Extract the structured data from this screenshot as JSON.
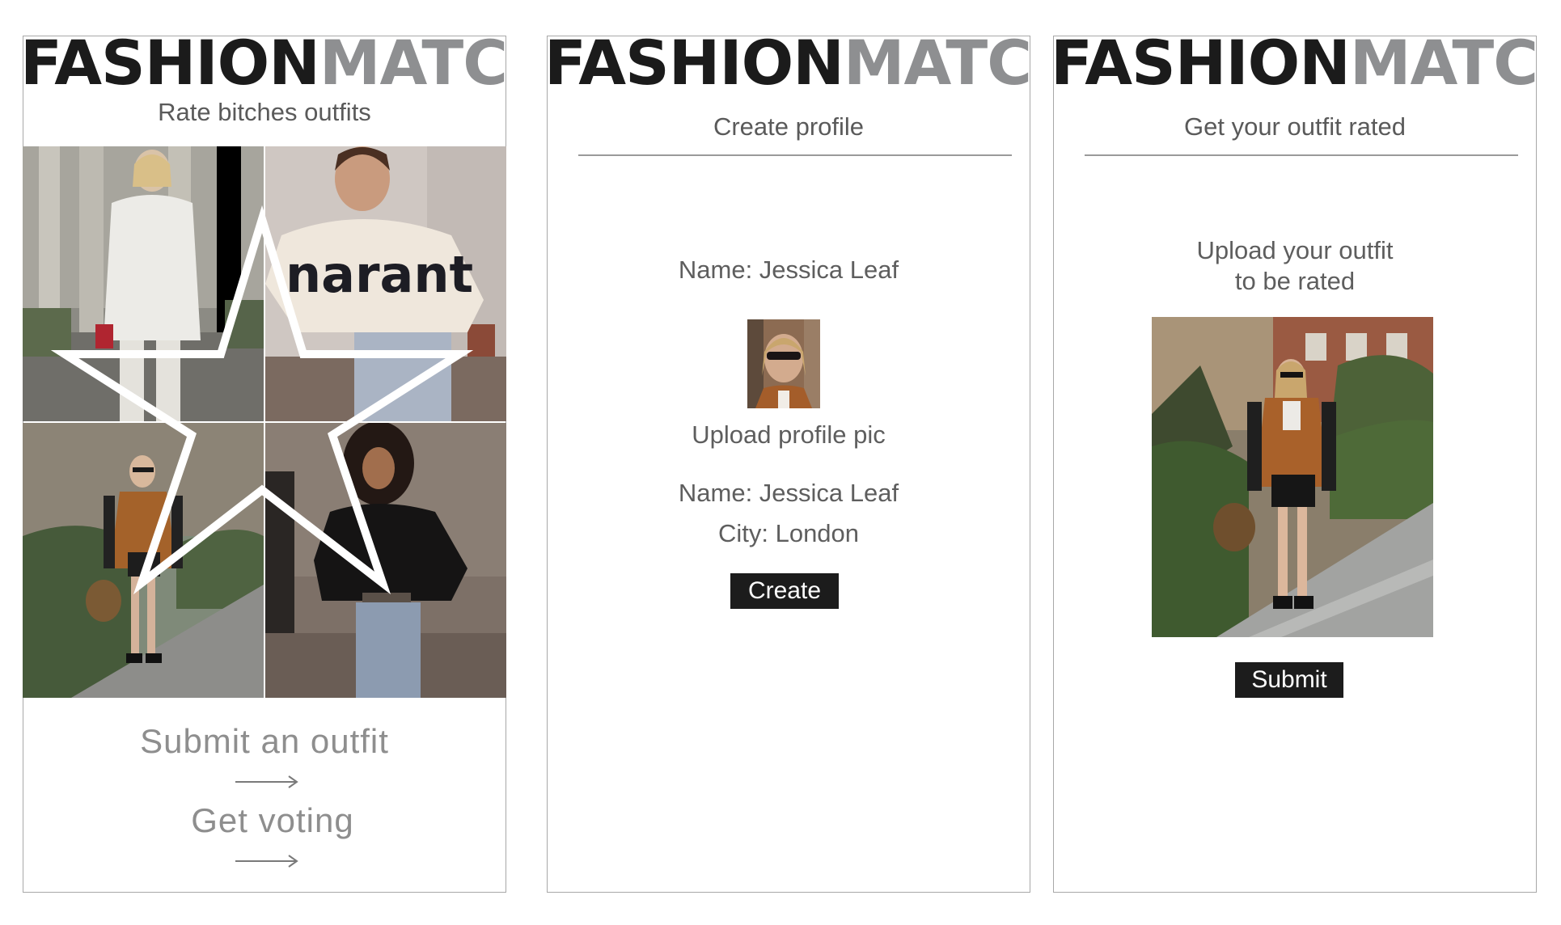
{
  "brand": {
    "part1": "FASHION",
    "part2": "MATCH"
  },
  "screens": [
    {
      "subtitle": "Rate bitches outfits",
      "images": [
        "woman in white blazer",
        "woman in isabel marant sweater",
        "woman in varsity jacket",
        "woman in black leather jacket"
      ],
      "star_icon": "star-outline",
      "cta1": "Submit an outfit",
      "cta2": "Get voting"
    },
    {
      "subtitle": "Create profile",
      "name_label": "Name: Jessica Leaf",
      "upload_label": "Upload profile pic",
      "name_value": "Name: Jessica Leaf",
      "city_value": "City: London",
      "button": "Create"
    },
    {
      "subtitle": "Get your outfit rated",
      "upload_line1": "Upload your outfit",
      "upload_line2": "to be rated",
      "button": "Submit"
    }
  ],
  "colors": {
    "logo_dark": "#1b1b1b",
    "logo_grey": "#8e8f91",
    "button_bg": "#1c1c1c",
    "border": "#a8a8a8"
  }
}
